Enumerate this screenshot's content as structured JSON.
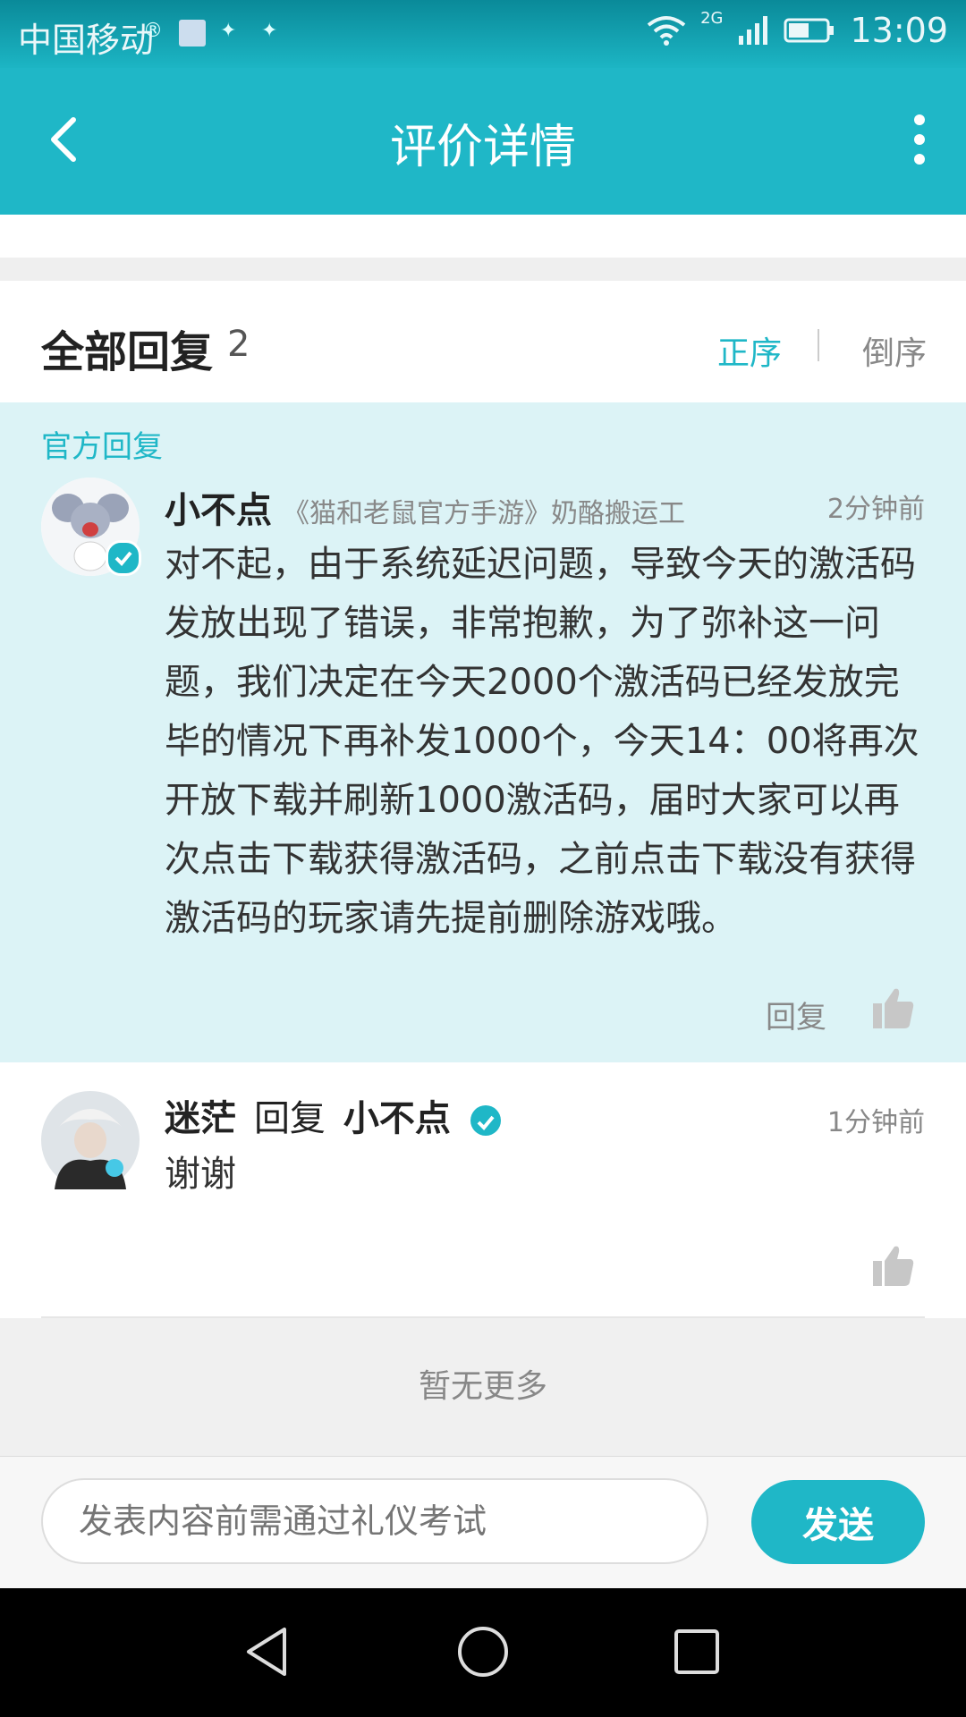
{
  "status": {
    "carrier": "中国移动",
    "network": "2G",
    "time": "13:09"
  },
  "app_bar": {
    "title": "评价详情"
  },
  "replies_header": {
    "title": "全部回复",
    "count": "2",
    "sort_asc": "正序",
    "sort_desc": "倒序"
  },
  "official_reply": {
    "section_label": "官方回复",
    "author": "小不点",
    "author_title": "《猫和老鼠官方手游》奶酪搬运工",
    "time": "2分钟前",
    "content": "对不起，由于系统延迟问题，导致今天的激活码发放出现了错误，非常抱歉，为了弥补这一问题，我们决定在今天2000个激活码已经发放完毕的情况下再补发1000个，今天14：00将再次开放下载并刷新1000激活码，届时大家可以再次点击下载获得激活码，之前点击下载没有获得激活码的玩家请先提前删除游戏哦。",
    "reply_label": "回复"
  },
  "comment": {
    "author": "迷茫",
    "reply_word": "回复",
    "reply_to": "小不点",
    "time": "1分钟前",
    "content": "谢谢"
  },
  "footer": {
    "no_more": "暂无更多"
  },
  "composer": {
    "placeholder": "发表内容前需通过礼仪考试",
    "send_label": "发送"
  },
  "colors": {
    "accent": "#1fb7c7",
    "official_bg": "#dcf3f6"
  },
  "icons": [
    "back-arrow-icon",
    "more-vertical-icon",
    "verified-icon",
    "thumbs-up-icon",
    "nav-back-icon",
    "nav-home-icon",
    "nav-recent-icon",
    "wifi-icon",
    "signal-icon",
    "battery-icon"
  ]
}
